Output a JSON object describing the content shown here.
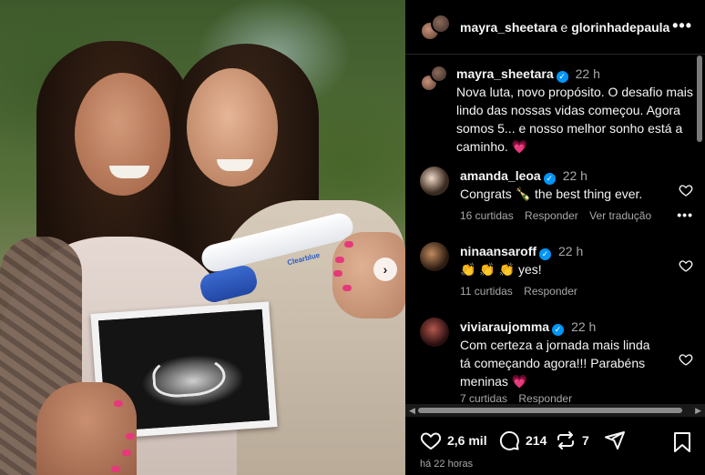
{
  "header": {
    "user1": "mayra_sheetara",
    "conjunction": "e",
    "user2": "glorinhadepaula",
    "more_icon": "more-horizontal-icon"
  },
  "photo": {
    "test_brand": "Clearblue",
    "next_icon": "chevron-right-icon"
  },
  "caption": {
    "username": "mayra_sheetara",
    "time": "22 h",
    "text": "Nova luta, novo propósito. O desafio mais lindo das nossas vidas começou. Agora somos 5... e nosso melhor sonho está a caminho. 💗"
  },
  "comments": [
    {
      "username": "amanda_leoa",
      "time": "22 h",
      "text": "Congrats 🍾 the best thing ever.",
      "likes": "16 curtidas",
      "reply": "Responder",
      "translate": "Ver tradução"
    },
    {
      "username": "ninaansaroff",
      "time": "22 h",
      "text": "👏 👏 👏 yes!",
      "likes": "11 curtidas",
      "reply": "Responder"
    },
    {
      "username": "viviaraujomma",
      "time": "22 h",
      "text": "Com certeza a jornada mais linda tá começando agora!!! Parabéns meninas 💗",
      "likes": "7 curtidas",
      "reply": "Responder"
    }
  ],
  "actions": {
    "likes": "2,6 mil",
    "comments": "214",
    "reposts": "7"
  },
  "timestamp": "há 22 horas",
  "colors": {
    "verified": "#0095f6",
    "background": "#000000",
    "secondary_text": "#a8a8a8"
  }
}
